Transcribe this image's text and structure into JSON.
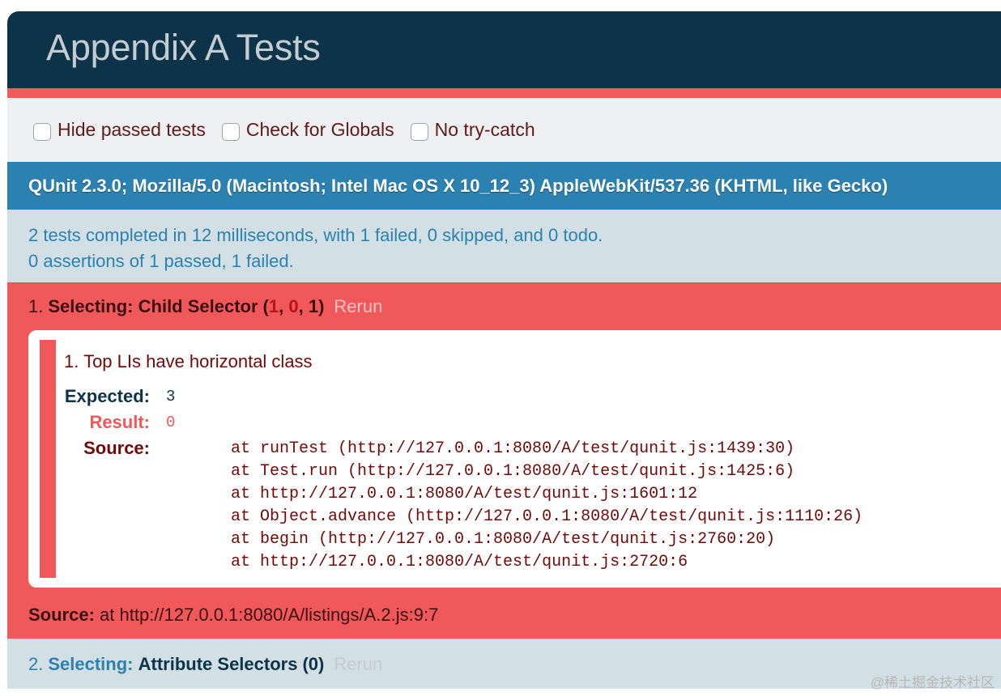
{
  "header": {
    "title": "Appendix A Tests"
  },
  "toolbar": {
    "options": [
      {
        "label": "Hide passed tests",
        "checked": false
      },
      {
        "label": "Check for Globals",
        "checked": false
      },
      {
        "label": "No try-catch",
        "checked": false
      }
    ]
  },
  "user_agent": "QUnit 2.3.0; Mozilla/5.0 (Macintosh; Intel Mac OS X 10_12_3) AppleWebKit/537.36 (KHTML, like Gecko)",
  "summary": {
    "line1": "2 tests completed in 12 milliseconds, with 1 failed, 0 skipped, and 0 todo.",
    "line2": "0 assertions of 1 passed, 1 failed."
  },
  "tests": [
    {
      "number": "1.",
      "module": "Selecting:",
      "name": "Child Selector",
      "counts": {
        "open": "(",
        "failed": "1",
        "sep1": ", ",
        "passed": "0",
        "sep2": ", ",
        "total": "1",
        "close": ")"
      },
      "rerun": "Rerun",
      "assertion": {
        "message": "1. Top LIs have horizontal class",
        "expected_label": "Expected:",
        "expected": "3",
        "result_label": "Result:",
        "result": "0",
        "source_label": "Source:",
        "stack": [
          "at runTest (http://127.0.0.1:8080/A/test/qunit.js:1439:30)",
          "at Test.run (http://127.0.0.1:8080/A/test/qunit.js:1425:6)",
          "at http://127.0.0.1:8080/A/test/qunit.js:1601:12",
          "at Object.advance (http://127.0.0.1:8080/A/test/qunit.js:1110:26)",
          "at begin (http://127.0.0.1:8080/A/test/qunit.js:2760:20)",
          "at http://127.0.0.1:8080/A/test/qunit.js:2720:6"
        ]
      },
      "source_label": "Source:",
      "source": " at http://127.0.0.1:8080/A/listings/A.2.js:9:7"
    },
    {
      "number": "2.",
      "module": "Selecting:",
      "name": "Attribute Selectors",
      "counts": "(0)",
      "rerun": "Rerun"
    }
  ],
  "watermark": "@稀土掘金技术社区",
  "colors": {
    "header_bg": "#0d3349",
    "fail_red": "#f0585a",
    "banner_blue": "#2b81af",
    "summary_bg": "#d2e0e6"
  }
}
